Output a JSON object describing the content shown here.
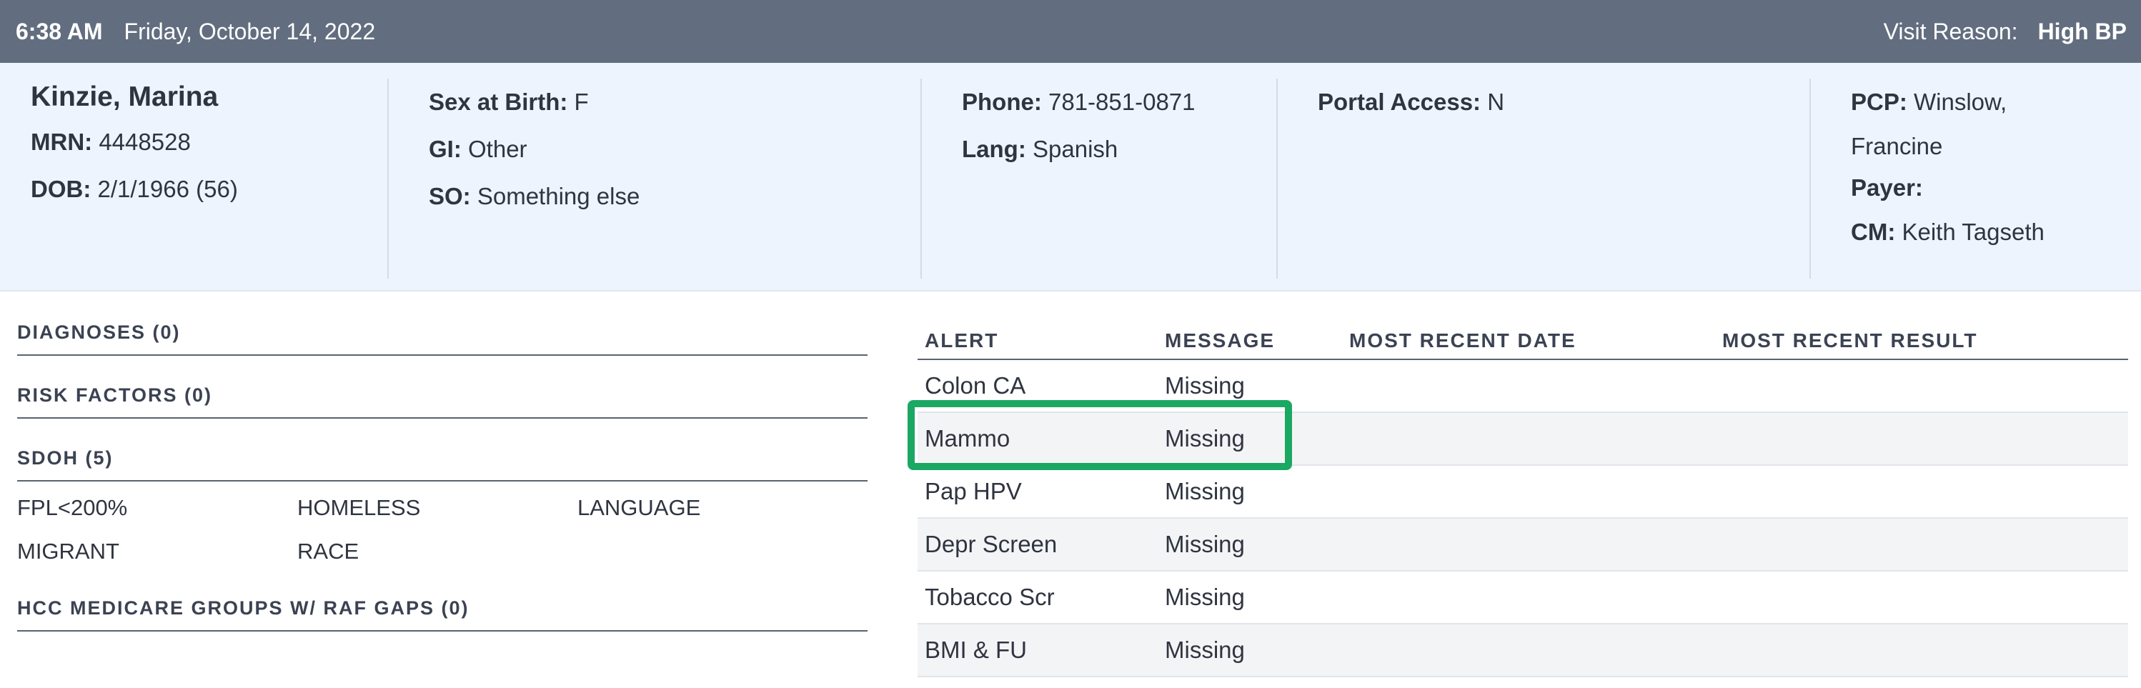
{
  "topbar": {
    "time": "6:38 AM",
    "date": "Friday, October 14, 2022",
    "visit_reason_label": "Visit Reason:",
    "visit_reason_value": "High BP"
  },
  "patient": {
    "name": "Kinzie, Marina",
    "mrn_label": "MRN:",
    "mrn": "4448528",
    "dob_label": "DOB:",
    "dob": "2/1/1966 (56)",
    "sex_label": "Sex at Birth:",
    "sex": "F",
    "gi_label": "GI:",
    "gi": "Other",
    "so_label": "SO:",
    "so": "Something else",
    "phone_label": "Phone:",
    "phone": "781-851-0871",
    "lang_label": "Lang:",
    "lang": "Spanish",
    "portal_label": "Portal Access:",
    "portal": "N",
    "pcp_label": "PCP:",
    "pcp_line1": "Winslow,",
    "pcp_line2": "Francine",
    "payer_label": "Payer:",
    "payer": "",
    "cm_label": "CM:",
    "cm": "Keith Tagseth"
  },
  "sections": {
    "diagnoses": "DIAGNOSES (0)",
    "risk_factors": "RISK FACTORS (0)",
    "sdoh": "SDOH (5)",
    "sdoh_items": [
      "FPL<200%",
      "HOMELESS",
      "LANGUAGE",
      "MIGRANT",
      "RACE"
    ],
    "hcc": "HCC MEDICARE GROUPS W/ RAF GAPS (0)"
  },
  "alerts": {
    "headers": [
      "ALERT",
      "MESSAGE",
      "MOST RECENT DATE",
      "MOST RECENT RESULT"
    ],
    "rows": [
      {
        "alert": "Colon CA",
        "message": "Missing",
        "date": "",
        "result": ""
      },
      {
        "alert": "Mammo",
        "message": "Missing",
        "date": "",
        "result": ""
      },
      {
        "alert": "Pap HPV",
        "message": "Missing",
        "date": "",
        "result": ""
      },
      {
        "alert": "Depr Screen",
        "message": "Missing",
        "date": "",
        "result": ""
      },
      {
        "alert": "Tobacco Scr",
        "message": "Missing",
        "date": "",
        "result": ""
      },
      {
        "alert": "BMI & FU",
        "message": "Missing",
        "date": "",
        "result": ""
      }
    ]
  },
  "colors": {
    "topbar": "#626e7f",
    "header_bg": "#edf4fd",
    "highlight": "#1aa863"
  }
}
